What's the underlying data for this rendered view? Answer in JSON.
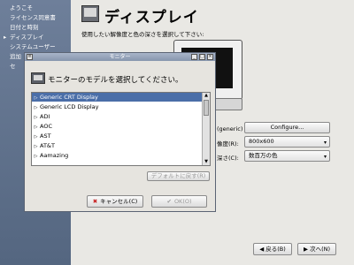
{
  "sidebar": {
    "items": [
      {
        "label": "ようこそ",
        "current": false
      },
      {
        "label": "ライセンス同意書",
        "current": false
      },
      {
        "label": "日付と時刻",
        "current": false
      },
      {
        "label": "ディスプレイ",
        "current": true
      },
      {
        "label": "システムユーザー",
        "current": false
      },
      {
        "label": "追加",
        "current": false
      },
      {
        "label": "セ",
        "current": false
      }
    ]
  },
  "main": {
    "title": "ディスプレイ",
    "instruction": "使用したい解像度と色の深さを選択して下さい:",
    "monitor_value": "(generic)",
    "configure_label": "Configure...",
    "resolution_label": "像度(R):",
    "resolution_value": "800x600",
    "depth_label": "深さ(C):",
    "depth_value": "数百万の色",
    "back_label": "戻る(B)",
    "next_label": "次へ(N)"
  },
  "dialog": {
    "title": "モニター",
    "prompt": "モニターのモデルを選択してください。",
    "models": [
      {
        "label": "Generic CRT Display",
        "selected": true
      },
      {
        "label": "Generic LCD Display",
        "selected": false
      },
      {
        "label": "ADI",
        "selected": false
      },
      {
        "label": "AOC",
        "selected": false
      },
      {
        "label": "AST",
        "selected": false
      },
      {
        "label": "AT&T",
        "selected": false
      },
      {
        "label": "Aamazing",
        "selected": false
      }
    ],
    "reset_label": "デフォルトに戻す(R)",
    "cancel_label": "キャンセル(C)",
    "ok_label": "OK(O)"
  },
  "colors": {
    "sidebar_bg": "#5f7190",
    "selection": "#4a6ea8",
    "titlebar": "#8796ae"
  }
}
